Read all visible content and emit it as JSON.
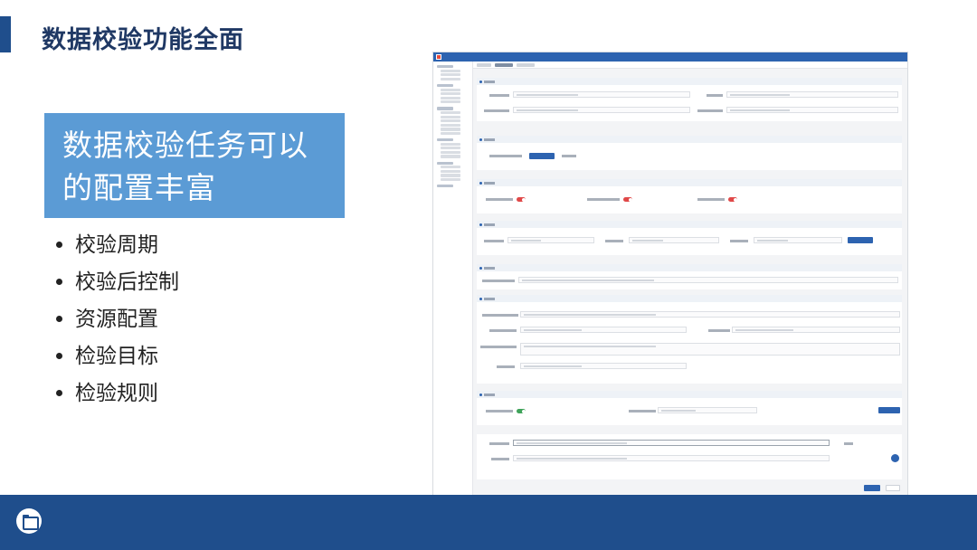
{
  "slide": {
    "title": "数据校验功能全面",
    "highlight": "数据校验任务可以的配置丰富",
    "bullets": [
      "校验周期",
      "校验后控制",
      "资源配置",
      "检验目标",
      "检验规则"
    ]
  },
  "colors": {
    "accent": "#1f4e8c",
    "highlight_box": "#5b9bd5",
    "app_primary": "#2d63b0",
    "toggle_off": "#e04848",
    "toggle_on": "#3fa35a"
  },
  "icons": {
    "footer": "folder-icon"
  }
}
